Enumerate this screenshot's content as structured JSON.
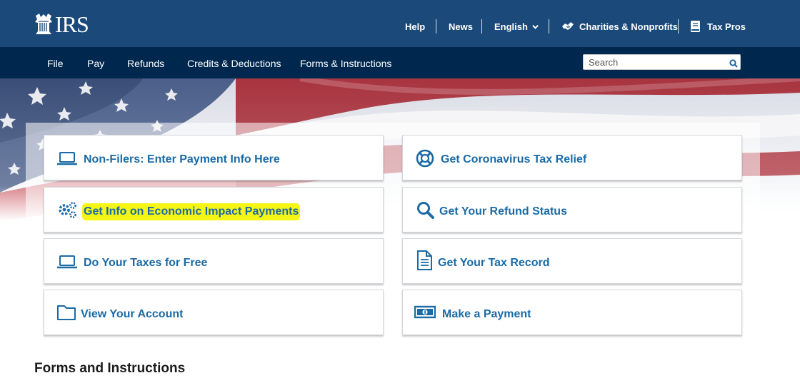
{
  "header": {
    "logo_text": "IRS",
    "utility_links": {
      "help": "Help",
      "news": "News",
      "language": "English",
      "charities": "Charities & Nonprofits",
      "tax_pros": "Tax Pros"
    }
  },
  "nav": {
    "items": [
      "File",
      "Pay",
      "Refunds",
      "Credits & Deductions",
      "Forms & Instructions"
    ],
    "search_placeholder": "Search"
  },
  "cards": [
    {
      "label": "Non-Filers: Enter Payment Info Here",
      "icon": "laptop-icon"
    },
    {
      "label": "Get Coronavirus Tax Relief",
      "icon": "lifebuoy-icon"
    },
    {
      "label": "Get Info on Economic Impact Payments",
      "icon": "gears-icon",
      "highlighted": true
    },
    {
      "label": "Get Your Refund Status",
      "icon": "search-icon"
    },
    {
      "label": "Do Your Taxes for Free",
      "icon": "laptop-icon"
    },
    {
      "label": "Get Your Tax Record",
      "icon": "document-icon"
    },
    {
      "label": "View Your Account",
      "icon": "folder-icon"
    },
    {
      "label": "Make a Payment",
      "icon": "money-icon"
    }
  ],
  "section_title": "Forms and Instructions",
  "colors": {
    "header": "#1b4a7a",
    "nav": "#00284f",
    "link": "#1b6aa5",
    "highlight": "#f5f516"
  }
}
